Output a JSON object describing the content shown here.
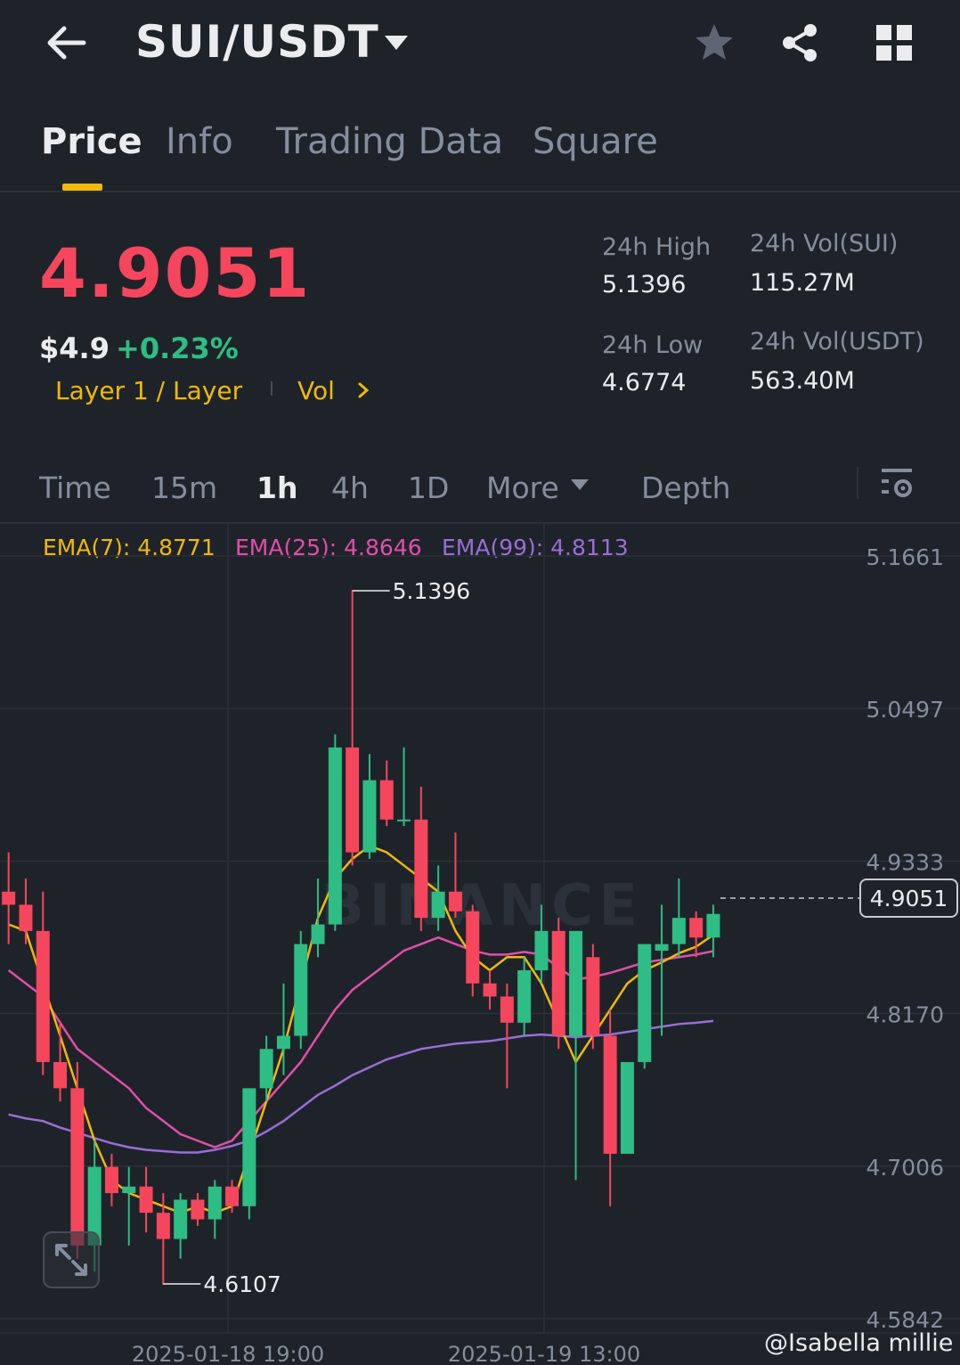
{
  "header": {
    "pair": "SUI/USDT",
    "icons": [
      "back-arrow-icon",
      "caret-down-icon",
      "star-icon",
      "share-icon",
      "grid-icon"
    ]
  },
  "tabs": [
    {
      "label": "Price",
      "active": true
    },
    {
      "label": "Info",
      "active": false
    },
    {
      "label": "Trading Data",
      "active": false
    },
    {
      "label": "Square",
      "active": false
    }
  ],
  "ticker": {
    "last_price": "4.9051",
    "usd_price": "$4.9",
    "change": "+0.23%",
    "tag_layer": "Layer 1 / Layer",
    "tag_vol": "Vol",
    "high_label": "24h High",
    "high_value": "5.1396",
    "low_label": "24h Low",
    "low_value": "4.6774",
    "vol_base_label": "24h Vol(SUI)",
    "vol_base_value": "115.27M",
    "vol_quote_label": "24h Vol(USDT)",
    "vol_quote_value": "563.40M"
  },
  "intervals": {
    "items": [
      "Time",
      "15m",
      "1h",
      "4h",
      "1D",
      "More",
      "Depth"
    ],
    "active": "1h"
  },
  "ema": {
    "ema7": "EMA(7): 4.8771",
    "ema25": "EMA(25): 4.8646",
    "ema99": "EMA(99): 4.8113"
  },
  "colors": {
    "up": "#2ebd85",
    "down": "#f6465d",
    "accent": "#f0b90b",
    "ema7": "#f0b90b",
    "ema25": "#e04fa9",
    "ema99": "#9b6dd6",
    "background": "#1e2329"
  },
  "chart_data": {
    "type": "candlestick",
    "price_ticks": [
      "5.1661",
      "5.0497",
      "4.9333",
      "4.8170",
      "4.7006",
      "4.5842"
    ],
    "ylim": [
      4.5842,
      5.1661
    ],
    "time_ticks": [
      "2025-01-18 19:00",
      "2025-01-19 13:00"
    ],
    "high_marker": "5.1396",
    "low_marker": "4.6107",
    "current_price": "4.9051",
    "candles": [
      {
        "o": 4.91,
        "h": 4.94,
        "l": 4.87,
        "c": 4.9
      },
      {
        "o": 4.9,
        "h": 4.92,
        "l": 4.87,
        "c": 4.88
      },
      {
        "o": 4.88,
        "h": 4.91,
        "l": 4.77,
        "c": 4.78
      },
      {
        "o": 4.78,
        "h": 4.81,
        "l": 4.75,
        "c": 4.76
      },
      {
        "o": 4.76,
        "h": 4.78,
        "l": 4.63,
        "c": 4.64
      },
      {
        "o": 4.64,
        "h": 4.72,
        "l": 4.62,
        "c": 4.7
      },
      {
        "o": 4.7,
        "h": 4.71,
        "l": 4.67,
        "c": 4.68
      },
      {
        "o": 4.68,
        "h": 4.7,
        "l": 4.64,
        "c": 4.685
      },
      {
        "o": 4.685,
        "h": 4.7,
        "l": 4.65,
        "c": 4.665
      },
      {
        "o": 4.665,
        "h": 4.68,
        "l": 4.61,
        "c": 4.645
      },
      {
        "o": 4.645,
        "h": 4.68,
        "l": 4.63,
        "c": 4.675
      },
      {
        "o": 4.675,
        "h": 4.68,
        "l": 4.655,
        "c": 4.66
      },
      {
        "o": 4.66,
        "h": 4.69,
        "l": 4.645,
        "c": 4.685
      },
      {
        "o": 4.685,
        "h": 4.69,
        "l": 4.665,
        "c": 4.67
      },
      {
        "o": 4.67,
        "h": 4.76,
        "l": 4.66,
        "c": 4.76
      },
      {
        "o": 4.76,
        "h": 4.8,
        "l": 4.75,
        "c": 4.79
      },
      {
        "o": 4.79,
        "h": 4.84,
        "l": 4.77,
        "c": 4.8
      },
      {
        "o": 4.8,
        "h": 4.88,
        "l": 4.79,
        "c": 4.87
      },
      {
        "o": 4.87,
        "h": 4.92,
        "l": 4.86,
        "c": 4.885
      },
      {
        "o": 4.885,
        "h": 5.03,
        "l": 4.88,
        "c": 5.02
      },
      {
        "o": 5.02,
        "h": 5.14,
        "l": 4.93,
        "c": 4.94
      },
      {
        "o": 4.94,
        "h": 5.015,
        "l": 4.935,
        "c": 4.995
      },
      {
        "o": 4.995,
        "h": 5.01,
        "l": 4.96,
        "c": 4.965
      },
      {
        "o": 4.965,
        "h": 5.02,
        "l": 4.96,
        "c": 4.965
      },
      {
        "o": 4.965,
        "h": 4.99,
        "l": 4.88,
        "c": 4.89
      },
      {
        "o": 4.89,
        "h": 4.93,
        "l": 4.88,
        "c": 4.91
      },
      {
        "o": 4.91,
        "h": 4.955,
        "l": 4.89,
        "c": 4.895
      },
      {
        "o": 4.895,
        "h": 4.9,
        "l": 4.83,
        "c": 4.84
      },
      {
        "o": 4.84,
        "h": 4.85,
        "l": 4.82,
        "c": 4.83
      },
      {
        "o": 4.83,
        "h": 4.84,
        "l": 4.76,
        "c": 4.81
      },
      {
        "o": 4.81,
        "h": 4.86,
        "l": 4.8,
        "c": 4.85
      },
      {
        "o": 4.85,
        "h": 4.9,
        "l": 4.84,
        "c": 4.88
      },
      {
        "o": 4.88,
        "h": 4.89,
        "l": 4.79,
        "c": 4.8
      },
      {
        "o": 4.8,
        "h": 4.86,
        "l": 4.69,
        "c": 4.88
      },
      {
        "o": 4.86,
        "h": 4.87,
        "l": 4.79,
        "c": 4.8
      },
      {
        "o": 4.8,
        "h": 4.82,
        "l": 4.67,
        "c": 4.71
      },
      {
        "o": 4.71,
        "h": 4.78,
        "l": 4.71,
        "c": 4.78
      },
      {
        "o": 4.78,
        "h": 4.87,
        "l": 4.775,
        "c": 4.87
      },
      {
        "o": 4.865,
        "h": 4.9,
        "l": 4.8,
        "c": 4.87
      },
      {
        "o": 4.87,
        "h": 4.92,
        "l": 4.86,
        "c": 4.89
      },
      {
        "o": 4.89,
        "h": 4.895,
        "l": 4.86,
        "c": 4.875
      },
      {
        "o": 4.875,
        "h": 4.9,
        "l": 4.86,
        "c": 4.893
      }
    ],
    "ema7": [
      4.885,
      4.88,
      4.84,
      4.8,
      4.76,
      4.72,
      4.69,
      4.68,
      4.675,
      4.67,
      4.665,
      4.67,
      4.665,
      4.67,
      4.71,
      4.75,
      4.79,
      4.84,
      4.89,
      4.92,
      4.935,
      4.945,
      4.94,
      4.93,
      4.92,
      4.91,
      4.88,
      4.86,
      4.85,
      4.86,
      4.86,
      4.84,
      4.81,
      4.78,
      4.8,
      4.82,
      4.84,
      4.85,
      4.856,
      4.863,
      4.868,
      4.877
    ],
    "ema25": [
      4.85,
      4.84,
      4.83,
      4.81,
      4.79,
      4.78,
      4.77,
      4.76,
      4.745,
      4.735,
      4.725,
      4.72,
      4.715,
      4.72,
      4.735,
      4.75,
      4.765,
      4.78,
      4.8,
      4.82,
      4.835,
      4.845,
      4.855,
      4.865,
      4.87,
      4.875,
      4.87,
      4.865,
      4.862,
      4.862,
      4.864,
      4.862,
      4.852,
      4.843,
      4.845,
      4.848,
      4.852,
      4.856,
      4.858,
      4.86,
      4.862,
      4.8646
    ],
    "ema99": [
      4.74,
      4.737,
      4.735,
      4.73,
      4.726,
      4.722,
      4.718,
      4.715,
      4.713,
      4.712,
      4.711,
      4.711,
      4.713,
      4.716,
      4.72,
      4.727,
      4.735,
      4.745,
      4.755,
      4.762,
      4.77,
      4.776,
      4.782,
      4.786,
      4.79,
      4.792,
      4.794,
      4.795,
      4.796,
      4.798,
      4.8,
      4.801,
      4.8,
      4.799,
      4.8,
      4.801,
      4.803,
      4.805,
      4.807,
      4.809,
      4.81,
      4.8113
    ]
  },
  "overlay": {
    "watermark": "BINANCE",
    "user_tag": "@Isabella millie"
  }
}
